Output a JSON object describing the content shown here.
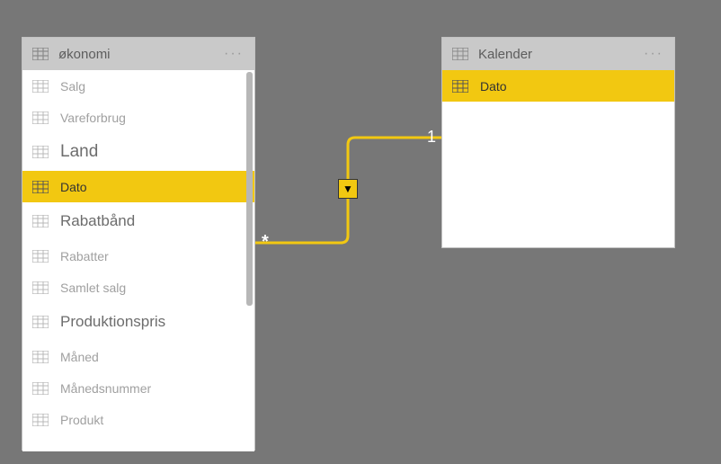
{
  "tables": {
    "okonomi": {
      "title": "økonomi",
      "fields": [
        {
          "label": "Salg",
          "style": "normal",
          "selected": false
        },
        {
          "label": "Vareforbrug",
          "style": "normal",
          "selected": false
        },
        {
          "label": "Land",
          "style": "big",
          "selected": false
        },
        {
          "label": "Dato",
          "style": "dark",
          "selected": true
        },
        {
          "label": "Rabatbånd",
          "style": "med",
          "selected": false
        },
        {
          "label": "Rabatter",
          "style": "normal",
          "selected": false
        },
        {
          "label": "Samlet salg",
          "style": "normal",
          "selected": false
        },
        {
          "label": "Produktionspris",
          "style": "med",
          "selected": false
        },
        {
          "label": "Måned",
          "style": "normal",
          "selected": false
        },
        {
          "label": "Månedsnummer",
          "style": "normal",
          "selected": false
        },
        {
          "label": "Produkt",
          "style": "normal",
          "selected": false
        }
      ]
    },
    "kalender": {
      "title": "Kalender",
      "fields": [
        {
          "label": "Dato",
          "style": "dark",
          "selected": true
        }
      ]
    }
  },
  "relationship": {
    "cardinality_one": "1",
    "cardinality_many": "*"
  },
  "colors": {
    "accent": "#f2c811"
  }
}
